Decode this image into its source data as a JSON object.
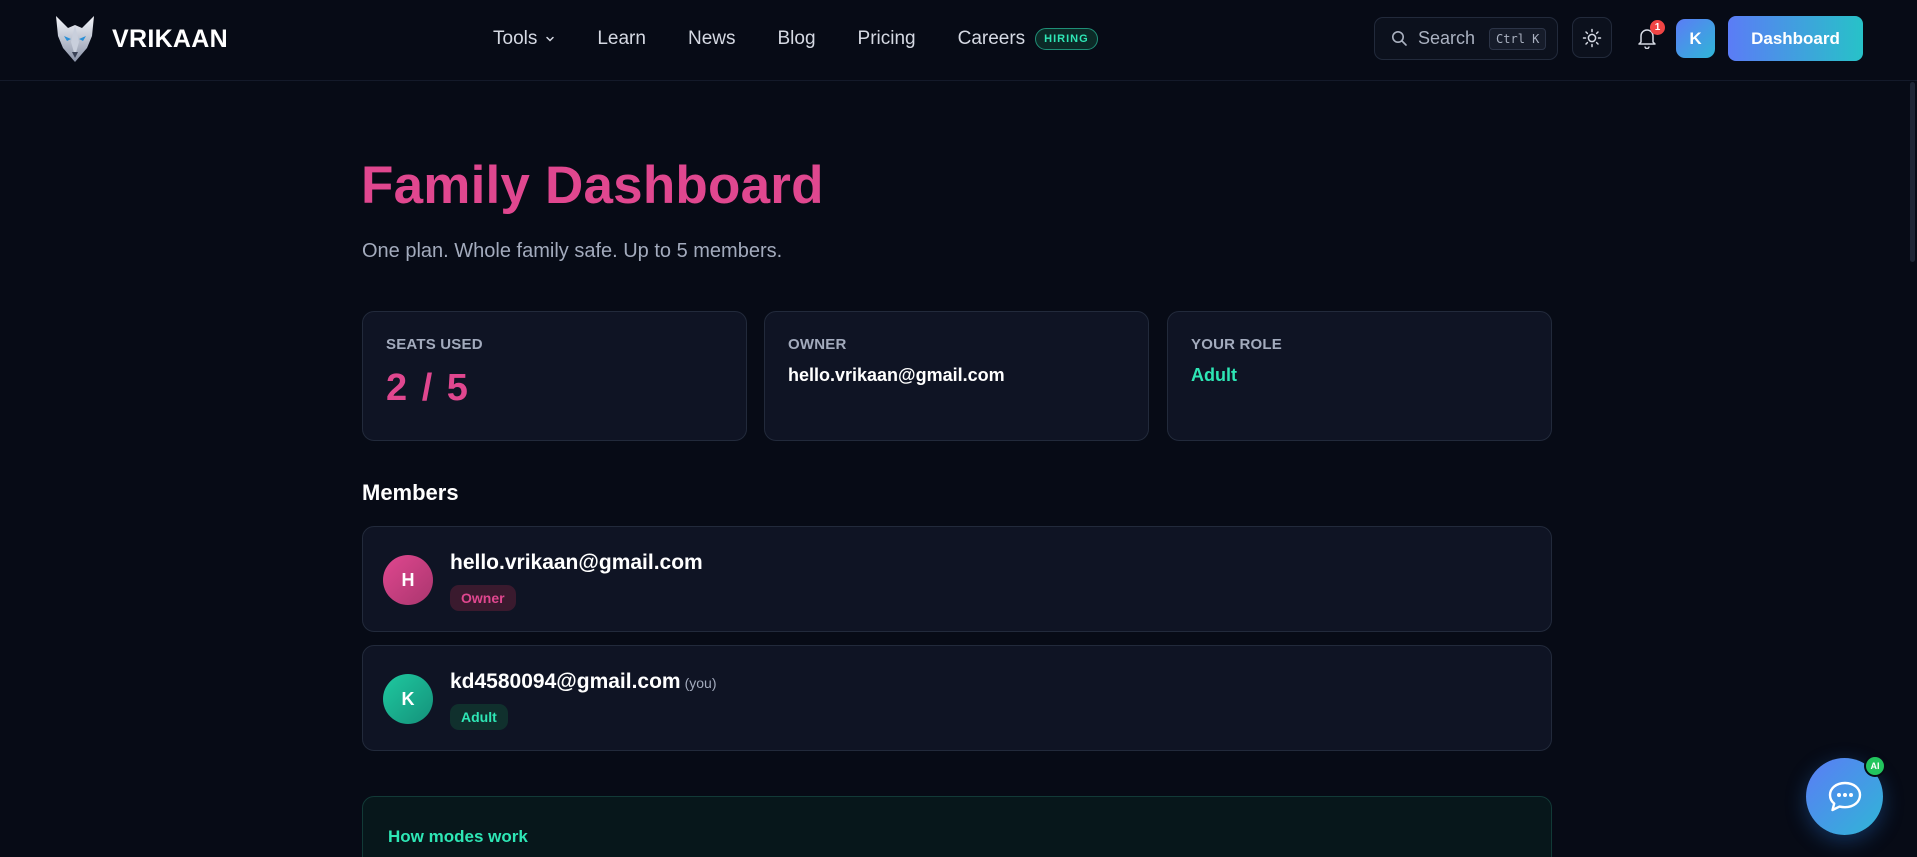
{
  "brand": {
    "name": "VRIKAAN"
  },
  "nav": {
    "items": [
      {
        "label": "Tools"
      },
      {
        "label": "Learn"
      },
      {
        "label": "News"
      },
      {
        "label": "Blog"
      },
      {
        "label": "Pricing"
      },
      {
        "label": "Careers",
        "badge": "HIRING"
      }
    ]
  },
  "header": {
    "search_label": "Search",
    "search_shortcut": "Ctrl K",
    "notification_count": "1",
    "avatar_initial": "K",
    "dashboard_label": "Dashboard"
  },
  "page": {
    "title": "Family Dashboard",
    "subtitle": "One plan. Whole family safe. Up to 5 members."
  },
  "stats": {
    "seats": {
      "label": "SEATS USED",
      "value": "2 / 5"
    },
    "owner": {
      "label": "OWNER",
      "value": "hello.vrikaan@gmail.com"
    },
    "role": {
      "label": "YOUR ROLE",
      "value": "Adult"
    }
  },
  "members": {
    "heading": "Members",
    "list": [
      {
        "initial": "H",
        "email": "hello.vrikaan@gmail.com",
        "you": "",
        "role": "Owner"
      },
      {
        "initial": "K",
        "email": "kd4580094@gmail.com",
        "you": "(you)",
        "role": "Adult"
      }
    ]
  },
  "modes": {
    "title": "How modes work"
  },
  "chat": {
    "badge": "AI"
  },
  "colors": {
    "background": "#070b16",
    "accent_pink": "#e0478f",
    "accent_teal": "#2ee6b5",
    "card_bg": "#0f1424",
    "gradient_start": "#5b7cf6",
    "gradient_end": "#27c2c8"
  },
  "icons": [
    "wolf-logo-icon",
    "chevron-down-icon",
    "search-icon",
    "sun-icon",
    "bell-icon",
    "chat-bubble-icon"
  ]
}
